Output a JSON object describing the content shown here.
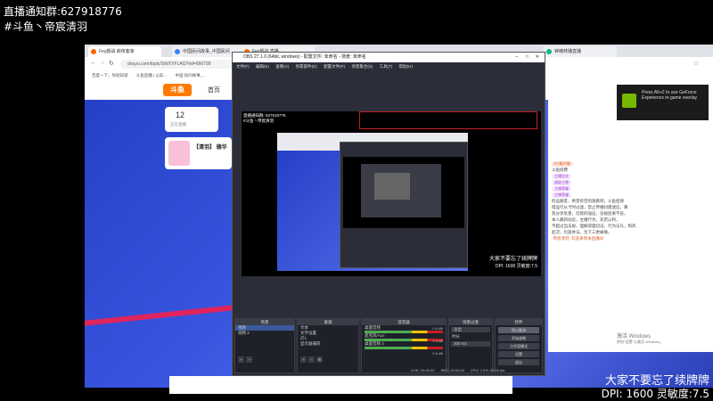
{
  "overlay": {
    "group_label": "直播通知群:627918776",
    "channel_label": "#斗鱼丶帝宸清羽",
    "bottom_caption": "大家不要忘了续牌牌",
    "dpi_line": "DPI: 1600 灵敏度:7.5",
    "watermark_line1": "激活 Windows",
    "watermark_line2": "转到\"设置\"以激活 Windows。"
  },
  "browser": {
    "tabs": [
      {
        "label": "Fey颜战 斜侠客家"
      },
      {
        "label": "中国民间故事_中国民间"
      },
      {
        "label": "Fey颜战 直播"
      },
      {
        "label": "钟楠林播直播"
      }
    ],
    "url": "douyu.com/topic/SWXYFLAG?rid=666799",
    "bookmarks": [
      "百度一下，你就知道",
      "斗鱼直播 | 以前...",
      "中国 民间故事_..."
    ],
    "site_nav": {
      "logo": "斗鱼",
      "home": "首页"
    },
    "stream_counter": "12",
    "stream_counter_label": "正在直播",
    "stream_title": "【清羽】 德华",
    "chat_items": [
      {
        "text": "PC客户端",
        "badge": ""
      },
      {
        "text": "斗鱼招聘",
        "badge": ""
      },
      {
        "text": "",
        "badge": "主播狂欢"
      },
      {
        "text": "",
        "badge": "超级主播"
      },
      {
        "text": "",
        "badge": "主播荣耀"
      },
      {
        "text": "",
        "badge": "主播荣耀"
      },
      {
        "text": "的运朋友，希望有空的观看吧，斗鱼担保",
        "badge": ""
      },
      {
        "text": "暗运行从卡时过滤，禁止传播封建迷信，暴",
        "badge": ""
      },
      {
        "text": "及分享危害，切莫的强迫，违规后果不良，",
        "badge": ""
      },
      {
        "text": "本人最新动态，主播行为，充足以利，",
        "badge": ""
      },
      {
        "text": "不超过当法规，理解得理切记，行为与礼，和风",
        "badge": ""
      },
      {
        "text": "起次，包容并法，包下三更被缘。",
        "badge": ""
      },
      {
        "text": "·帝宸清羽·  欢迎来到本直播间",
        "badge": ""
      }
    ],
    "gfx_overlay": "Press Alt+Z to use GeForce Experience in-game overlay"
  },
  "obs": {
    "title": "OBS 27.1.0 (64bit, windows) - 配置文件: 未命名 - 场景: 未命名",
    "menu": [
      "文件(F)",
      "编辑(E)",
      "查看(V)",
      "停靠部件(D)",
      "配置文件(P)",
      "场景集合(S)",
      "工具(T)",
      "帮助(H)"
    ],
    "preview_label1": "直播通知群: 627918776",
    "preview_label2": "#斗鱼丶帝宸清羽",
    "preview_caption": "大家不要忘了续牌牌",
    "preview_dpi": "DPI: 1600 灵敏度:7.5",
    "docks": {
      "scenes": {
        "title": "场景",
        "items": [
          "视频",
          "视频 2"
        ]
      },
      "sources": {
        "title": "来源",
        "items": [
          "文本",
          "文字设置",
          "灯1",
          "显示器捕获"
        ]
      },
      "mixer": {
        "title": "混音器",
        "tracks": [
          "桌面音频",
          "麦克风/Aux",
          "桌面音频 2"
        ],
        "levels": [
          "0.0 dB",
          "0.0 dB",
          "0.0 dB"
        ]
      },
      "transitions": {
        "title": "场景过渡",
        "type": "淡出",
        "duration_label": "时长",
        "duration": "300 ms"
      },
      "controls": {
        "title": "控件",
        "buttons": [
          "停止推流",
          "开始录制",
          "工作室模式",
          "设置",
          "退出"
        ]
      }
    },
    "statusbar": {
      "live": "LIVE: 00:00:00",
      "rec": "REC: 00:00:00",
      "cpu": "CPU: 2.9%, 60.00 fps"
    }
  },
  "colors": {
    "hero_blue": "#3a56e0",
    "douyu_orange": "#ff7a00",
    "obs_bg": "#2b2e38",
    "rec_red": "#c81d25"
  }
}
